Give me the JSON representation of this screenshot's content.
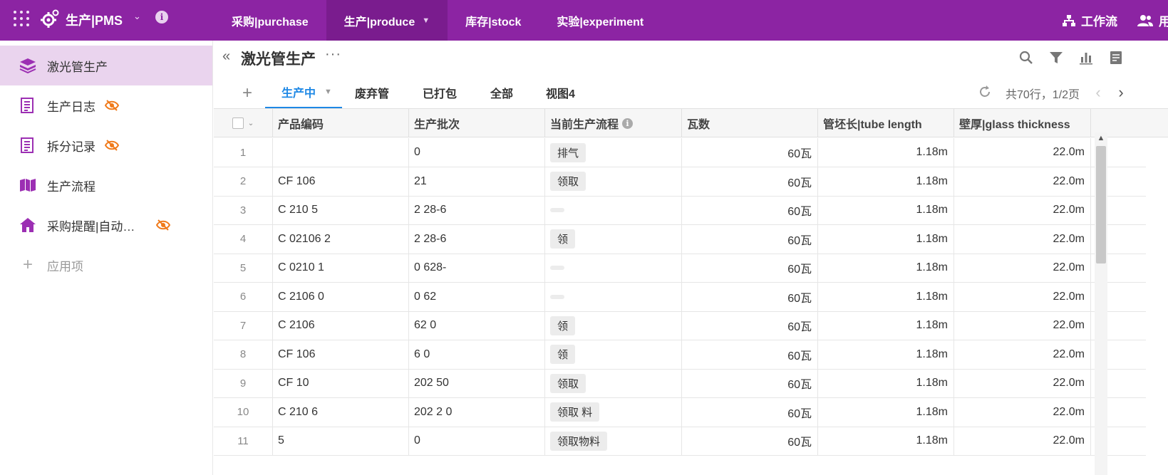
{
  "topbar": {
    "app_title": "生产|PMS",
    "nav": [
      {
        "label": "采购|purchase",
        "active": false
      },
      {
        "label": "生产|produce",
        "active": true
      },
      {
        "label": "库存|stock",
        "active": false
      },
      {
        "label": "实验|experiment",
        "active": false
      }
    ],
    "workflow_label": "工作流",
    "user_label": "用",
    "colors": {
      "accent": "#8c24a3",
      "active_nav": "#7a1c8e"
    }
  },
  "sidebar": {
    "items": [
      {
        "label": "激光管生产",
        "icon": "layers-icon",
        "hidden": false
      },
      {
        "label": "生产日志",
        "icon": "form-icon",
        "hidden": true
      },
      {
        "label": "拆分记录",
        "icon": "form-icon",
        "hidden": true
      },
      {
        "label": "生产流程",
        "icon": "map-icon",
        "hidden": false
      },
      {
        "label": "采购提醒|自动…",
        "icon": "home-icon",
        "hidden": true
      }
    ],
    "add_label": "应用项"
  },
  "main": {
    "title": "激光管生产",
    "tabs": [
      {
        "label": "生产中",
        "active": true
      },
      {
        "label": "废弃管",
        "active": false
      },
      {
        "label": "已打包",
        "active": false
      },
      {
        "label": "全部",
        "active": false
      },
      {
        "label": "视图4",
        "active": false
      }
    ],
    "page_info": "共70行，1/2页"
  },
  "table": {
    "columns": [
      "产品编码",
      "生产批次",
      "当前生产流程",
      "瓦数",
      "管坯长|tube length",
      "壁厚|glass thickness"
    ],
    "rows": [
      {
        "idx": "1",
        "code": "",
        "batch": "0",
        "process": "排气",
        "watt": "60瓦",
        "length": "1.18m",
        "thickness": "22.0m"
      },
      {
        "idx": "2",
        "code": "CF 106",
        "batch": "21",
        "process": "领取",
        "watt": "60瓦",
        "length": "1.18m",
        "thickness": "22.0m"
      },
      {
        "idx": "3",
        "code": "C 210 5",
        "batch": "2 28-6",
        "process": "",
        "watt": "60瓦",
        "length": "1.18m",
        "thickness": "22.0m"
      },
      {
        "idx": "4",
        "code": "C 02106 2",
        "batch": "2 28-6",
        "process": "领",
        "watt": "60瓦",
        "length": "1.18m",
        "thickness": "22.0m"
      },
      {
        "idx": "5",
        "code": "C 0210 1",
        "batch": "0 628-",
        "process": "",
        "watt": "60瓦",
        "length": "1.18m",
        "thickness": "22.0m"
      },
      {
        "idx": "6",
        "code": "C 2106 0",
        "batch": "0 62",
        "process": "",
        "watt": "60瓦",
        "length": "1.18m",
        "thickness": "22.0m"
      },
      {
        "idx": "7",
        "code": "C 2106",
        "batch": "62 0",
        "process": "领",
        "watt": "60瓦",
        "length": "1.18m",
        "thickness": "22.0m"
      },
      {
        "idx": "8",
        "code": "CF 106",
        "batch": "6 0",
        "process": "领",
        "watt": "60瓦",
        "length": "1.18m",
        "thickness": "22.0m"
      },
      {
        "idx": "9",
        "code": "CF 10",
        "batch": "202 50",
        "process": "领取",
        "watt": "60瓦",
        "length": "1.18m",
        "thickness": "22.0m"
      },
      {
        "idx": "10",
        "code": "C 210 6",
        "batch": "202 2 0",
        "process": "领取 料",
        "watt": "60瓦",
        "length": "1.18m",
        "thickness": "22.0m"
      },
      {
        "idx": "11",
        "code": "5",
        "batch": "0",
        "process": "领取物料",
        "watt": "60瓦",
        "length": "1.18m",
        "thickness": "22.0m"
      }
    ]
  }
}
